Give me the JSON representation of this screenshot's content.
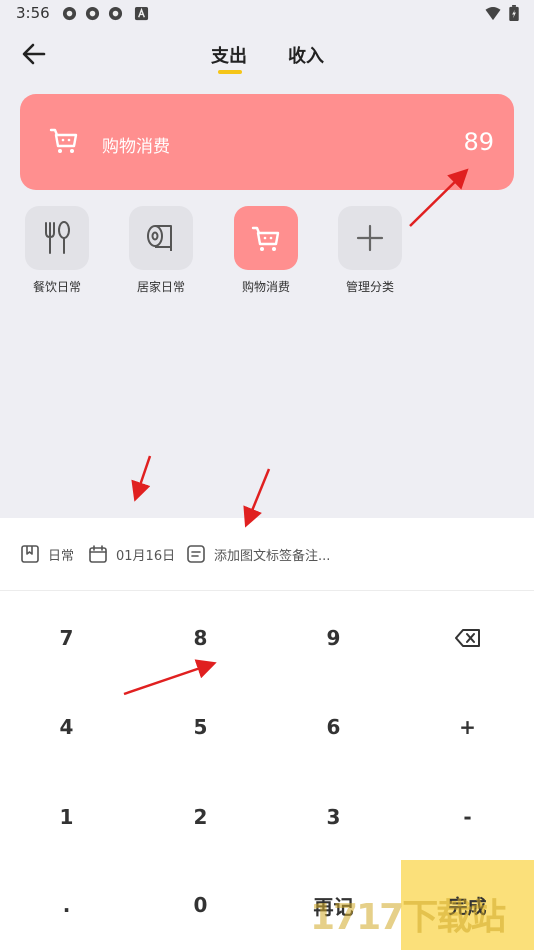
{
  "status_bar": {
    "time": "3:56"
  },
  "tabs": [
    {
      "label": "支出",
      "active": true
    },
    {
      "label": "收入",
      "active": false
    }
  ],
  "selected": {
    "label": "购物消费",
    "amount": "89",
    "color": "#ff8f8f"
  },
  "categories": [
    {
      "label": "餐饮日常",
      "icon": "fork-spoon-icon"
    },
    {
      "label": "居家日常",
      "icon": "tissue-roll-icon"
    },
    {
      "label": "购物消费",
      "icon": "shopping-cart-icon",
      "active": true
    },
    {
      "label": "管理分类",
      "icon": "plus-icon"
    }
  ],
  "info_bar": {
    "book": "日常",
    "date": "01月16日",
    "note_placeholder": "添加图文标签备注..."
  },
  "keypad": {
    "k7": "7",
    "k8": "8",
    "k9": "9",
    "k4": "4",
    "k5": "5",
    "k6": "6",
    "plus": "+",
    "k1": "1",
    "k2": "2",
    "k3": "3",
    "minus": "-",
    "dot": ".",
    "k0": "0",
    "again": "再记",
    "done": "完成"
  },
  "watermark": "1717下载站"
}
